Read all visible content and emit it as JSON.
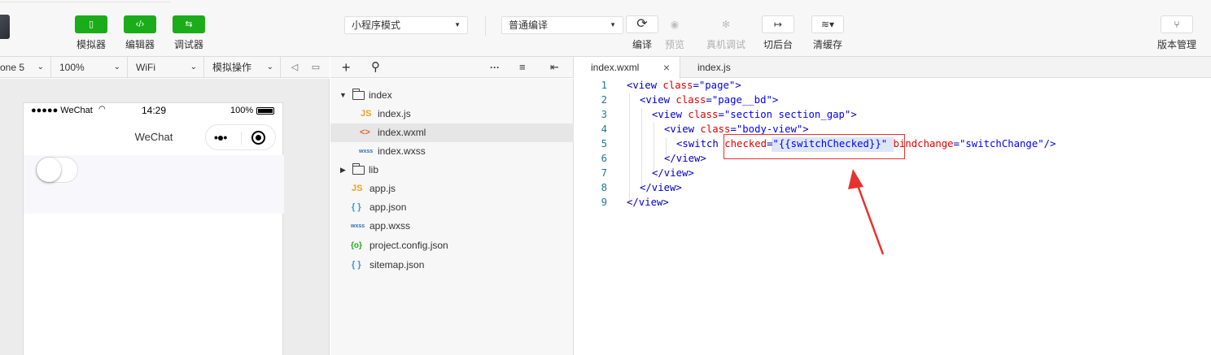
{
  "toolbar": {
    "simulator": {
      "label": "模拟器",
      "icon": "phone-icon"
    },
    "editor": {
      "label": "编辑器",
      "icon": "code-icon"
    },
    "debugger": {
      "label": "调试器",
      "icon": "sliders-icon"
    },
    "mode_select": "小程序模式",
    "compile_select": "普通编译",
    "compile": {
      "label": "编译",
      "icon": "refresh-icon"
    },
    "preview": {
      "label": "预览",
      "icon": "eye-icon"
    },
    "remote_debug": {
      "label": "真机调试",
      "icon": "bug-icon"
    },
    "background": {
      "label": "切后台",
      "icon": "switch-background-icon"
    },
    "clear_cache": {
      "label": "清缓存",
      "icon": "layers-icon"
    },
    "version": {
      "label": "版本管理",
      "icon": "branch-icon"
    }
  },
  "simulator": {
    "device": "one 5",
    "zoom": "100%",
    "network": "WiFi",
    "operations": "模拟操作",
    "status": {
      "carrier": "●●●●● WeChat",
      "time": "14:29",
      "battery": "100%"
    },
    "nav_title": "WeChat",
    "switch_checked": false
  },
  "explorer": {
    "items": [
      {
        "name": "index",
        "type": "folder",
        "expanded": true
      },
      {
        "name": "index.js",
        "type": "js",
        "badge": "JS"
      },
      {
        "name": "index.wxml",
        "type": "wxml",
        "badge": "<>"
      },
      {
        "name": "index.wxss",
        "type": "wxss",
        "badge": "wxss"
      },
      {
        "name": "lib",
        "type": "folder",
        "expanded": false
      },
      {
        "name": "app.js",
        "type": "js",
        "badge": "JS"
      },
      {
        "name": "app.json",
        "type": "json",
        "badge": "{ }"
      },
      {
        "name": "app.wxss",
        "type": "wxss",
        "badge": "wxss"
      },
      {
        "name": "project.config.json",
        "type": "config",
        "badge": "{o}"
      },
      {
        "name": "sitemap.json",
        "type": "json",
        "badge": "{ }"
      }
    ]
  },
  "editor": {
    "tabs": [
      {
        "label": "index.wxml",
        "active": true
      },
      {
        "label": "index.js",
        "active": false
      }
    ],
    "lines": [
      {
        "num": "1",
        "tokens": [
          [
            "tag",
            "<view "
          ],
          [
            "attr",
            "class"
          ],
          [
            "tag",
            "="
          ],
          [
            "str",
            "\"page\""
          ],
          [
            "tag",
            ">"
          ]
        ]
      },
      {
        "num": "2",
        "tokens": [
          [
            "tag",
            "<view "
          ],
          [
            "attr",
            "class"
          ],
          [
            "tag",
            "="
          ],
          [
            "str",
            "\"page__bd\""
          ],
          [
            "tag",
            ">"
          ]
        ]
      },
      {
        "num": "3",
        "tokens": [
          [
            "tag",
            "<view "
          ],
          [
            "attr",
            "class"
          ],
          [
            "tag",
            "="
          ],
          [
            "str",
            "\"section section_gap\""
          ],
          [
            "tag",
            ">"
          ]
        ]
      },
      {
        "num": "4",
        "tokens": [
          [
            "tag",
            "<view "
          ],
          [
            "attr",
            "class"
          ],
          [
            "tag",
            "="
          ],
          [
            "str",
            "\"body-view\""
          ],
          [
            "tag",
            ">"
          ]
        ]
      },
      {
        "num": "5",
        "tokens": [
          [
            "tag",
            "<switch "
          ],
          [
            "attr",
            "checked"
          ],
          [
            "tag",
            "="
          ],
          [
            "str",
            "\"{{switchChecked}}\""
          ],
          [
            "tag",
            " "
          ],
          [
            "attr",
            "bindchange"
          ],
          [
            "tag",
            "="
          ],
          [
            "str",
            "\"switchChange\""
          ],
          [
            "tag",
            "/>"
          ]
        ]
      },
      {
        "num": "6",
        "tokens": [
          [
            "tag",
            "</view>"
          ]
        ]
      },
      {
        "num": "7",
        "tokens": [
          [
            "tag",
            "</view>"
          ]
        ]
      },
      {
        "num": "8",
        "tokens": [
          [
            "tag",
            "</view>"
          ]
        ]
      },
      {
        "num": "9",
        "tokens": [
          [
            "tag",
            "</view>"
          ]
        ]
      }
    ]
  },
  "colors": {
    "accent": "#1aad19",
    "annotation": "#e8322f",
    "tag": "#0000c8",
    "attr": "#e00000",
    "string": "#0000ff"
  }
}
